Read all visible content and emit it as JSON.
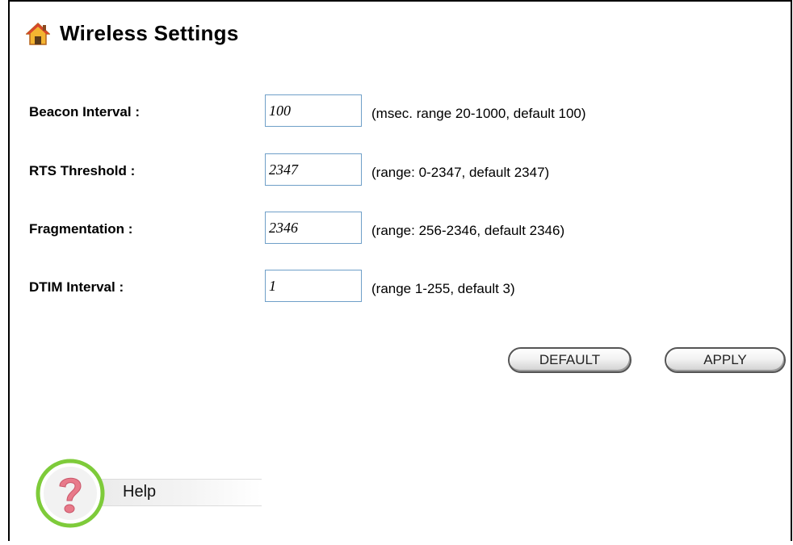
{
  "page": {
    "title": "Wireless Settings"
  },
  "settings": [
    {
      "label": "Beacon Interval :",
      "value": "100",
      "hint": "(msec. range 20-1000, default 100)"
    },
    {
      "label": "RTS Threshold :",
      "value": "2347",
      "hint": "(range: 0-2347, default 2347)"
    },
    {
      "label": "Fragmentation :",
      "value": "2346",
      "hint": "(range: 256-2346, default 2346)"
    },
    {
      "label": "DTIM Interval :",
      "value": "1",
      "hint": "(range 1-255, default 3)"
    }
  ],
  "buttons": {
    "default_label": "DEFAULT",
    "apply_label": "APPLY"
  },
  "help": {
    "label": "Help"
  },
  "icons": {
    "title": "home-icon",
    "help": "help-question-icon"
  },
  "colors": {
    "field_border": "#6f9fc8",
    "help_ring": "#7ecb3a",
    "help_fill": "#e87a8a"
  }
}
